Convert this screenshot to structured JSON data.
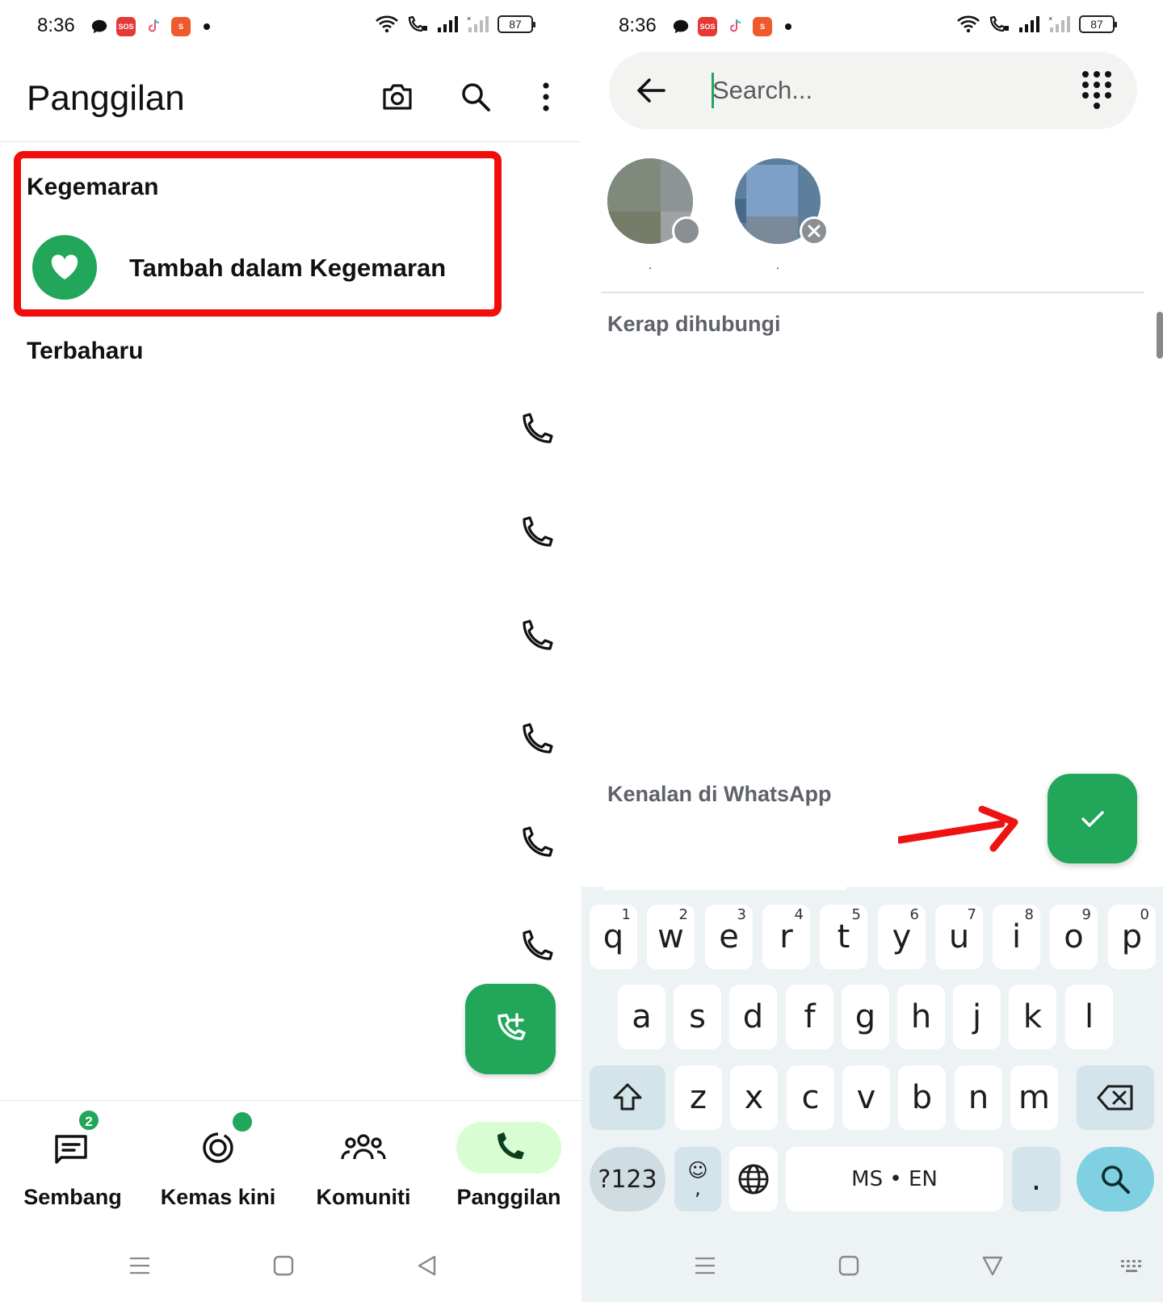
{
  "status_bar": {
    "time": "8:36",
    "battery": "87",
    "icons": [
      "chat-bubble-icon",
      "sos-icon",
      "tiktok-icon",
      "shopee-icon",
      "wifi-icon",
      "wifi-call-icon",
      "signal-icon",
      "signal-off-icon"
    ]
  },
  "left": {
    "header": {
      "title": "Panggilan"
    },
    "favourites": {
      "label": "Kegemaran",
      "add_label": "Tambah dalam Kegemaran"
    },
    "recent": {
      "label": "Terbaharu",
      "call_rows": 6
    },
    "bottom_nav": {
      "items": [
        {
          "label": "Sembang",
          "badge": "2",
          "icon": "chat-icon"
        },
        {
          "label": "Kemas kini",
          "icon": "updates-icon"
        },
        {
          "label": "Komuniti",
          "icon": "community-icon"
        },
        {
          "label": "Panggilan",
          "icon": "phone-icon",
          "active": true
        }
      ]
    }
  },
  "right": {
    "search": {
      "placeholder": "Search..."
    },
    "selected_contacts": [
      {
        "name": "."
      },
      {
        "name": "."
      }
    ],
    "sections": {
      "frequent": "Kerap dihubungi",
      "known": "Kenalan di WhatsApp"
    },
    "keyboard": {
      "row1": [
        {
          "k": "q",
          "s": "1"
        },
        {
          "k": "w",
          "s": "2"
        },
        {
          "k": "e",
          "s": "3"
        },
        {
          "k": "r",
          "s": "4"
        },
        {
          "k": "t",
          "s": "5"
        },
        {
          "k": "y",
          "s": "6"
        },
        {
          "k": "u",
          "s": "7"
        },
        {
          "k": "i",
          "s": "8"
        },
        {
          "k": "o",
          "s": "9"
        },
        {
          "k": "p",
          "s": "0"
        }
      ],
      "row2": [
        "a",
        "s",
        "d",
        "f",
        "g",
        "h",
        "j",
        "k",
        "l"
      ],
      "row3": [
        "z",
        "x",
        "c",
        "v",
        "b",
        "n",
        "m"
      ],
      "symbols_label": "?123",
      "emoji_label": "☺",
      "comma_label": ",",
      "space_label": "MS • EN",
      "period_label": "."
    }
  },
  "colors": {
    "accent": "#21a65a",
    "highlight": "#f20d0d",
    "nav_active": "#d8fdd2"
  }
}
